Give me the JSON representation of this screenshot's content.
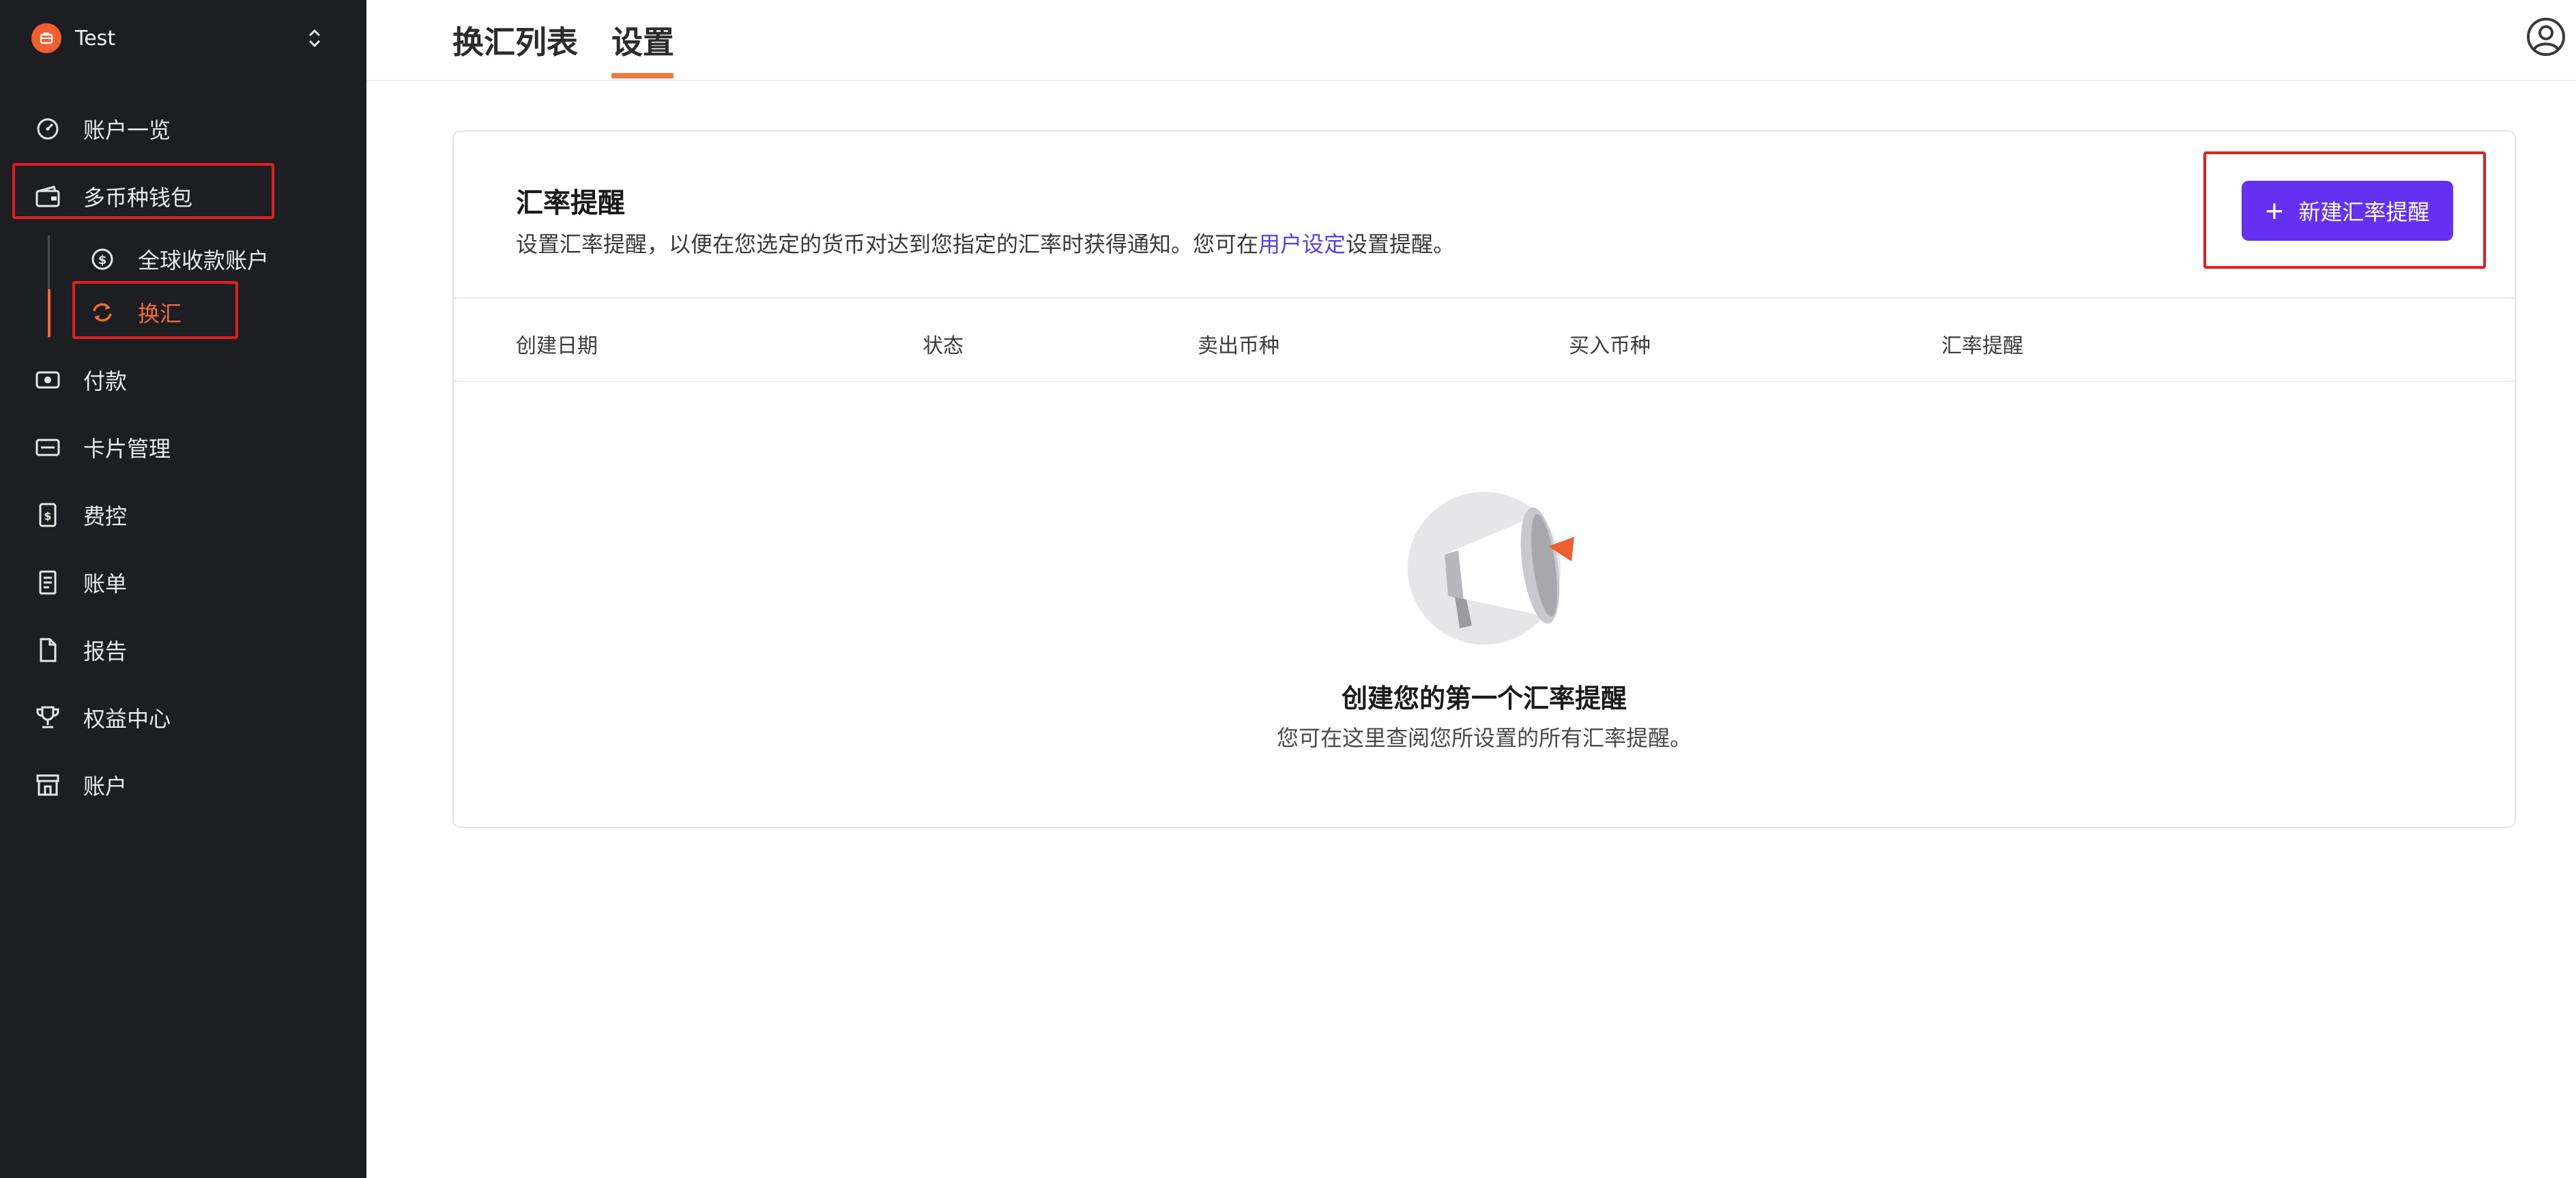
{
  "sidebar": {
    "org_name": "Test",
    "items": [
      {
        "label": "账户一览",
        "icon": "dashboard-gauge-icon"
      },
      {
        "label": "多币种钱包",
        "icon": "wallet-icon"
      },
      {
        "label": "付款",
        "icon": "payment-eye-icon"
      },
      {
        "label": "卡片管理",
        "icon": "card-icon"
      },
      {
        "label": "费控",
        "icon": "expense-doc-icon"
      },
      {
        "label": "账单",
        "icon": "bill-icon"
      },
      {
        "label": "报告",
        "icon": "report-file-icon"
      },
      {
        "label": "权益中心",
        "icon": "trophy-icon"
      },
      {
        "label": "账户",
        "icon": "store-icon"
      }
    ],
    "sub_items": [
      {
        "label": "全球收款账户",
        "icon": "dollar-coin-icon"
      },
      {
        "label": "换汇",
        "icon": "exchange-refresh-icon",
        "active": true
      }
    ],
    "active_color": "#f06a3a"
  },
  "header": {
    "tabs": [
      {
        "label": "换汇列表"
      },
      {
        "label": "设置",
        "active": true
      }
    ]
  },
  "card": {
    "title": "汇率提醒",
    "desc_before": "设置汇率提醒，以便在您选定的货币对达到您指定的汇率时获得通知。您可在",
    "desc_link": "用户设定",
    "desc_after": "设置提醒。",
    "new_button": "新建汇率提醒",
    "columns": [
      "创建日期",
      "状态",
      "卖出币种",
      "买入币种",
      "汇率提醒"
    ],
    "empty_title": "创建您的第一个汇率提醒",
    "empty_subtitle": "您可在这里查阅您所设置的所有汇率提醒。"
  },
  "colors": {
    "primary": "#6431f0",
    "accent": "#f06a3a",
    "highlight_box": "#e02020"
  }
}
